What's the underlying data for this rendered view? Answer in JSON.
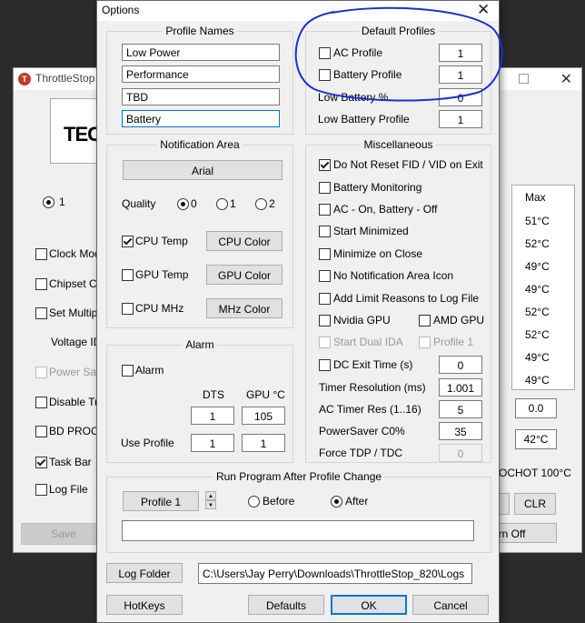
{
  "bg_window": {
    "title": "ThrottleStop",
    "logo_text": "TEC",
    "radio_label": "1",
    "checkboxes": [
      {
        "label": "Clock Modu",
        "checked": false
      },
      {
        "label": "Chipset Clo",
        "checked": false
      },
      {
        "label": "Set Multiplie",
        "checked": false
      },
      {
        "label": "Power Save",
        "checked": false
      },
      {
        "label": "Disable Tur",
        "checked": false
      },
      {
        "label": "BD PROCHO",
        "checked": false
      },
      {
        "label": "Task Bar",
        "checked": true
      },
      {
        "label": "Log File",
        "checked": false
      }
    ],
    "voltage_label": "Voltage ID",
    "table_header": "Max",
    "table_values": [
      "51°C",
      "52°C",
      "49°C",
      "49°C",
      "52°C",
      "52°C",
      "49°C",
      "49°C"
    ],
    "field_1": "0.0",
    "field_2": "42°C",
    "prochot_label": "OCHOT 100°C",
    "clr_label": "CLR",
    "save_label": "Save",
    "turn_off_label": "urn Off"
  },
  "dialog": {
    "title": "Options",
    "profile_names": {
      "title": "Profile Names",
      "values": [
        "Low Power",
        "Performance",
        "TBD",
        "Battery"
      ]
    },
    "default_profiles": {
      "title": "Default Profiles",
      "ac_profile_label": "AC Profile",
      "ac_profile_value": "1",
      "battery_profile_label": "Battery Profile",
      "battery_profile_value": "1",
      "low_battery_pct_label": "Low Battery %",
      "low_battery_pct_value": "0",
      "low_battery_profile_label": "Low Battery Profile",
      "low_battery_profile_value": "1"
    },
    "notification": {
      "title": "Notification Area",
      "font_button": "Arial",
      "quality_label": "Quality",
      "quality_options": [
        "0",
        "1",
        "2"
      ],
      "cpu_temp_label": "CPU Temp",
      "cpu_color_button": "CPU Color",
      "gpu_temp_label": "GPU Temp",
      "gpu_color_button": "GPU Color",
      "cpu_mhz_label": "CPU MHz",
      "mhz_color_button": "MHz Color"
    },
    "misc": {
      "title": "Miscellaneous",
      "checkboxes": [
        {
          "label": "Do Not Reset FID / VID on Exit",
          "checked": true
        },
        {
          "label": "Battery Monitoring",
          "checked": false
        },
        {
          "label": "AC - On, Battery - Off",
          "checked": false
        },
        {
          "label": "Start Minimized",
          "checked": false
        },
        {
          "label": "Minimize on Close",
          "checked": false
        },
        {
          "label": "No Notification Area Icon",
          "checked": false
        },
        {
          "label": "Add Limit Reasons to Log File",
          "checked": false
        }
      ],
      "nvidia_label": "Nvidia GPU",
      "amd_label": "AMD GPU",
      "start_dual_label": "Start Dual IDA",
      "profile1_label": "Profile 1",
      "dc_exit_label": "DC Exit Time (s)",
      "dc_exit_value": "0",
      "timer_res_label": "Timer Resolution (ms)",
      "timer_res_value": "1.001",
      "ac_timer_label": "AC Timer Res (1..16)",
      "ac_timer_value": "5",
      "powersaver_label": "PowerSaver C0%",
      "powersaver_value": "35",
      "force_tdp_label": "Force TDP / TDC",
      "force_tdp_value": "0"
    },
    "alarm": {
      "title": "Alarm",
      "alarm_label": "Alarm",
      "dts_label": "DTS",
      "gpu_label": "GPU °C",
      "dts_value": "1",
      "gpu_value": "105",
      "use_profile_label": "Use Profile",
      "use_profile_dts": "1",
      "use_profile_gpu": "1"
    },
    "run_program": {
      "title": "Run Program After Profile Change",
      "profile_button": "Profile 1",
      "before_label": "Before",
      "after_label": "After",
      "program_path": ""
    },
    "log_folder_button": "Log Folder",
    "log_folder_path": "C:\\Users\\Jay Perry\\Downloads\\ThrottleStop_820\\Logs",
    "hotkeys_button": "HotKeys",
    "defaults_button": "Defaults",
    "ok_button": "OK",
    "cancel_button": "Cancel"
  },
  "colors": {
    "annotation": "#1a2fd6",
    "dialog_bg": "#f0f0f0",
    "focus": "#0078d7"
  }
}
